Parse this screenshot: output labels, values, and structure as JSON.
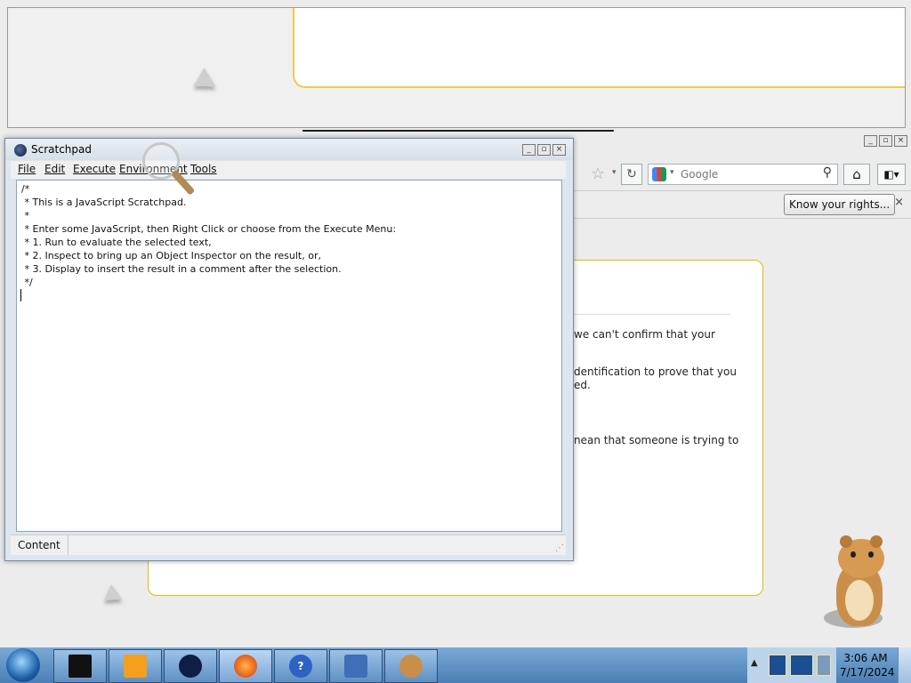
{
  "scratchpad": {
    "title": "Scratchpad",
    "menu": [
      "File",
      "Edit",
      "Execute",
      "Environment",
      "Tools"
    ],
    "code_lines": [
      "/*",
      " * This is a JavaScript Scratchpad.",
      " *",
      " * Enter some JavaScript, then Right Click or choose from the Execute Menu:",
      " * 1. Run to evaluate the selected text,",
      " * 2. Inspect to bring up an Object Inspector on the result, or,",
      " * 3. Display to insert the result in a comment after the selection.",
      " */"
    ],
    "status": "Content"
  },
  "browser": {
    "search_placeholder": "Google",
    "notice_button": "Know your rights...",
    "notice_close": "×",
    "card_lines": [
      "we can't confirm that your",
      "dentification to prove that you",
      "ed.",
      "nean that someone is trying to"
    ]
  },
  "taskbar": {
    "clock_time": "3:06 AM",
    "clock_date": "7/17/2024",
    "apps": [
      "terminal-icon",
      "media-player-icon",
      "game-controller-icon",
      "firefox-icon",
      "help-icon",
      "network-icon",
      "hamster-icon"
    ]
  }
}
